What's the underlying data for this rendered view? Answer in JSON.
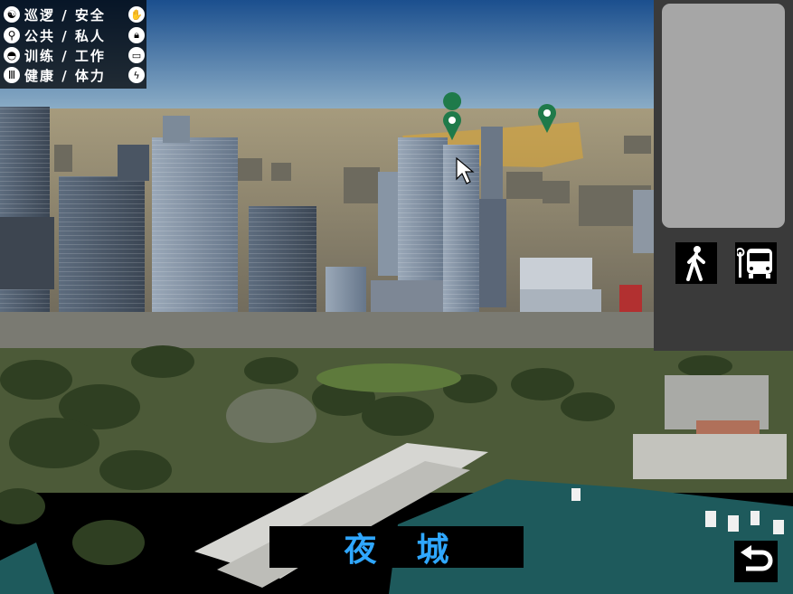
{
  "legend": {
    "rows": [
      {
        "text": "巡逻 / 安全",
        "left_icon": "patrol-icon",
        "right_icon": "hand-icon"
      },
      {
        "text": "公共 / 私人",
        "left_icon": "walking-person-icon",
        "right_icon": "lock-icon"
      },
      {
        "text": "训练 / 工作",
        "left_icon": "cap-icon",
        "right_icon": "briefcase-icon"
      },
      {
        "text": "健康 / 体力",
        "left_icon": "grill-icon",
        "right_icon": "lightning-icon"
      }
    ]
  },
  "map": {
    "markers": [
      "map-pin-icon",
      "map-pin-icon"
    ],
    "marker_color": "#1f7a4a",
    "highlight_color": "#e0a830",
    "water_color": "#1e5a5c"
  },
  "side_panel": {
    "buttons": [
      {
        "icon": "walking-icon"
      },
      {
        "icon": "bus-stop-icon"
      }
    ]
  },
  "title": {
    "text": "夜城",
    "color": "#2fa7ff"
  },
  "back_button": {
    "icon": "back-arrow-icon"
  }
}
